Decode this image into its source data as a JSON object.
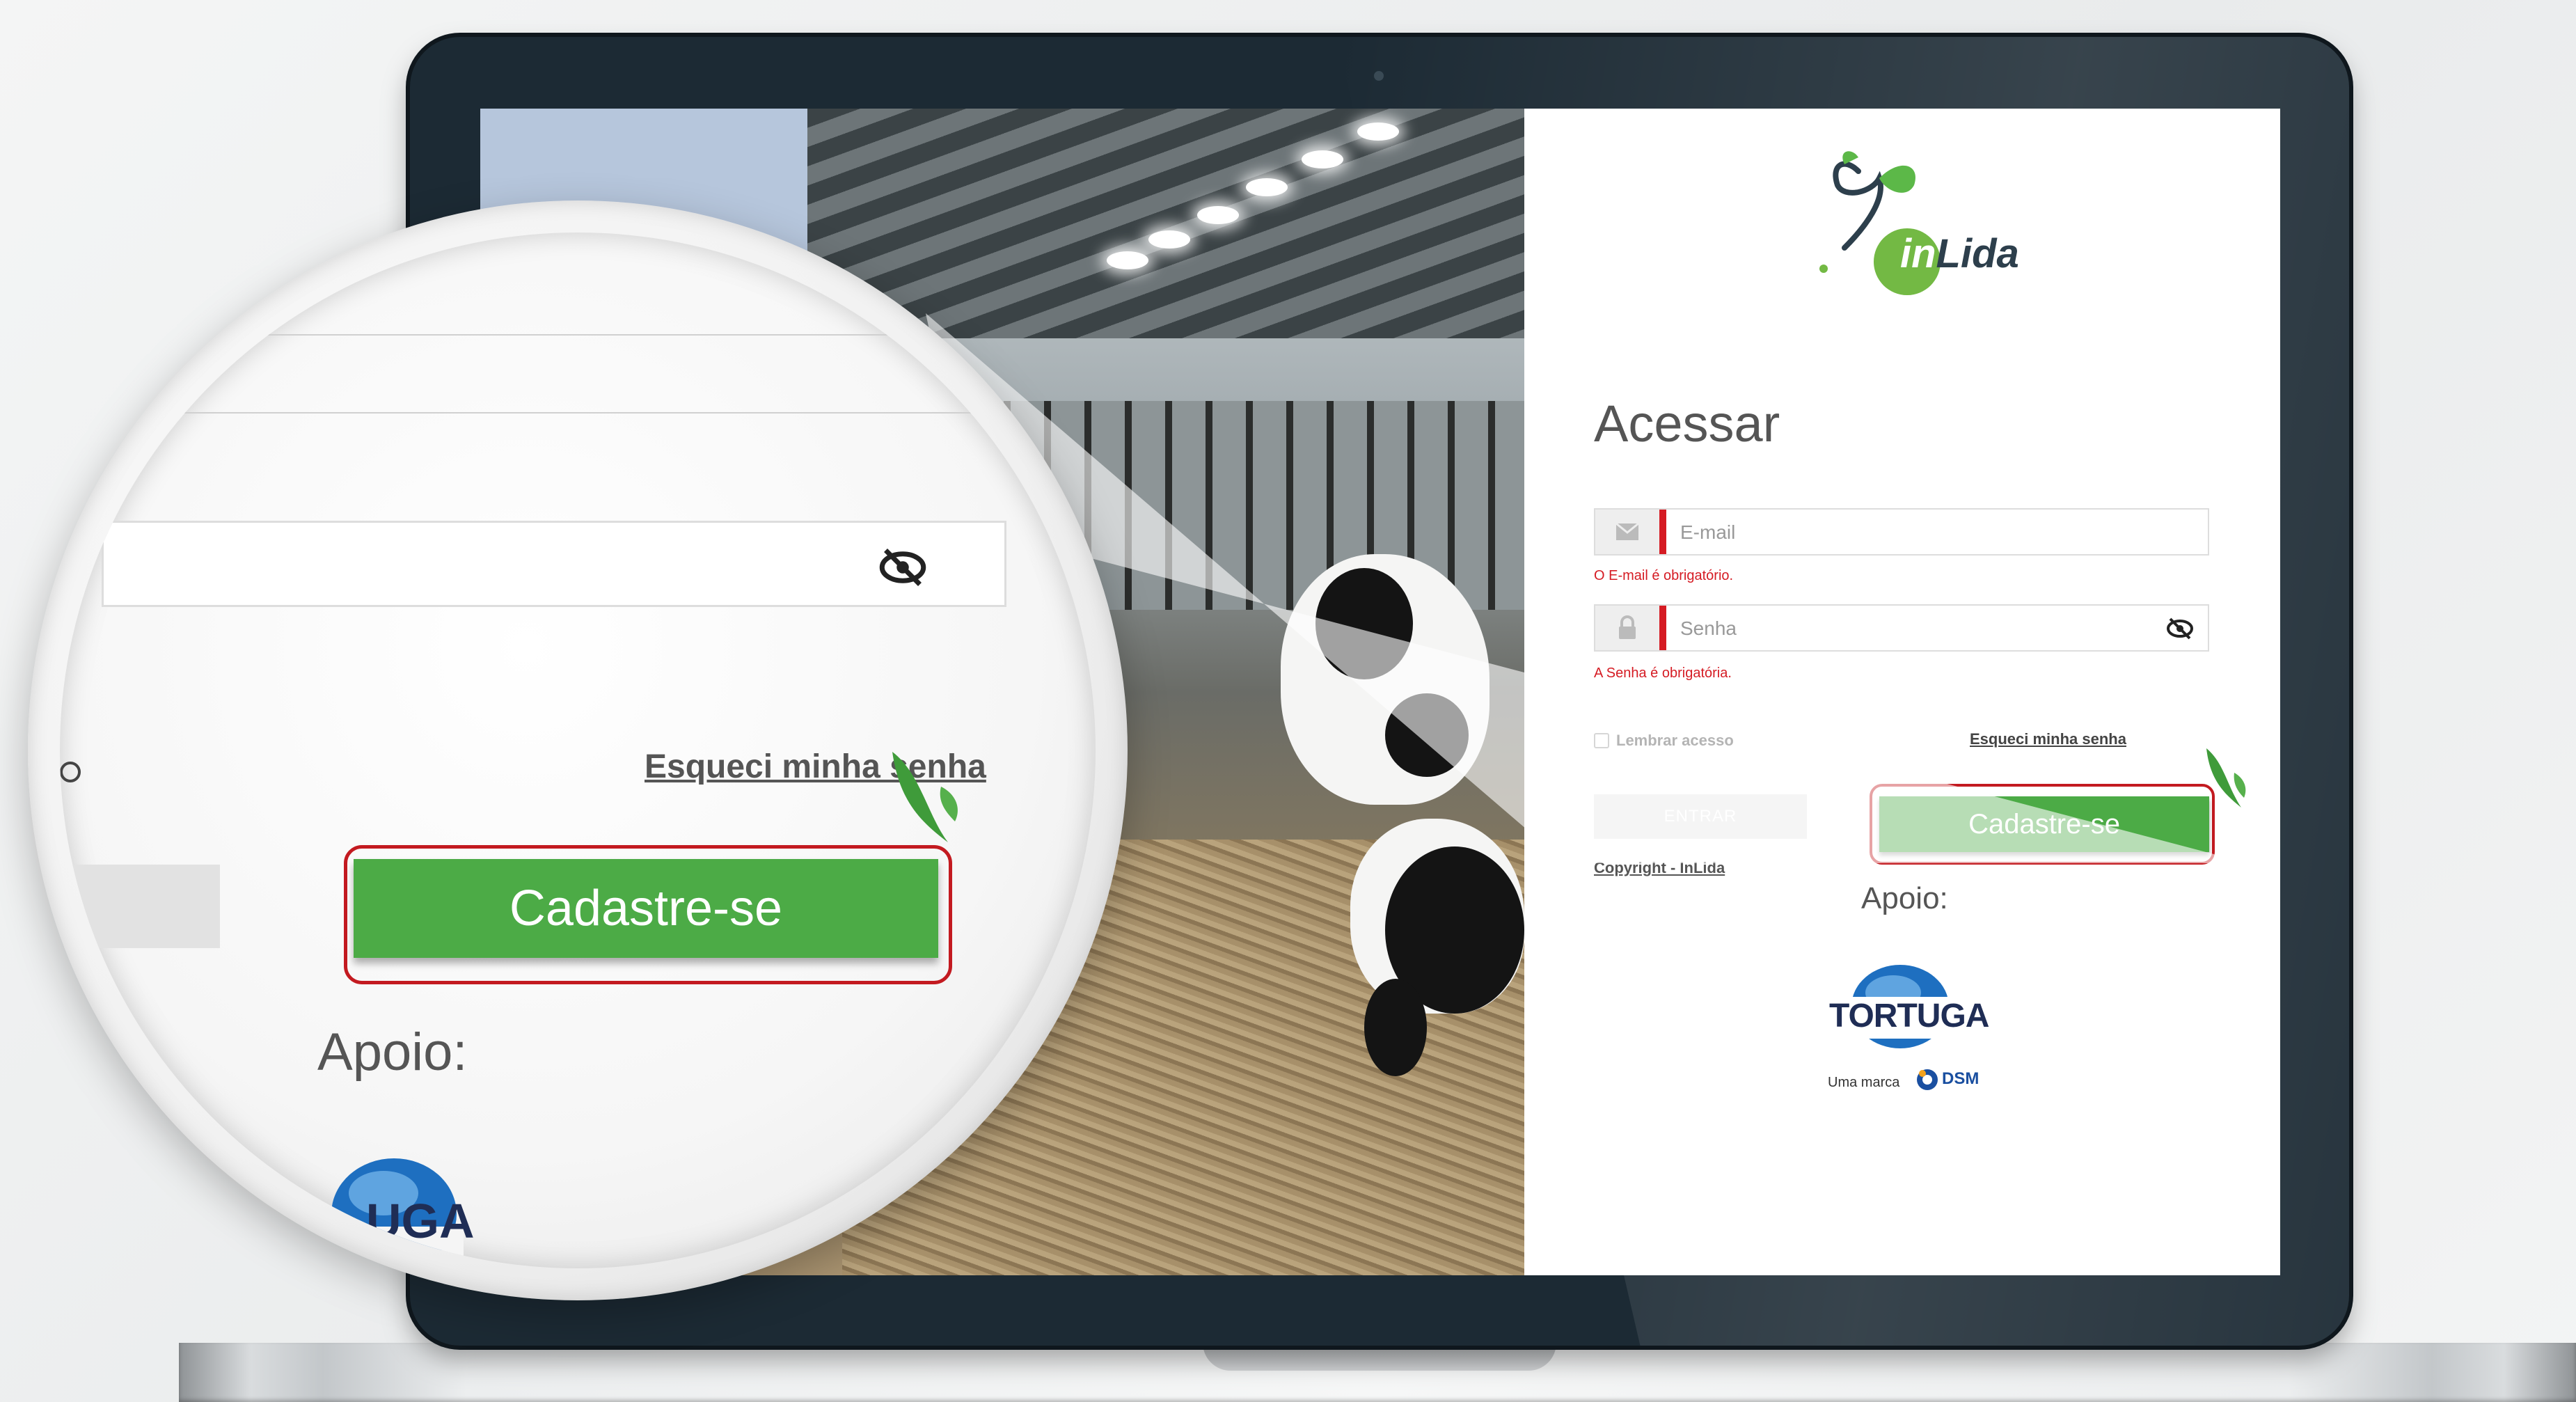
{
  "app": {
    "name": "InLida"
  },
  "login": {
    "title": "Acessar",
    "email": {
      "placeholder": "E-mail",
      "value": "",
      "error": "O E-mail é obrigatório."
    },
    "password": {
      "placeholder": "Senha",
      "value": "",
      "error": "A Senha é obrigatória."
    },
    "remember_label": "Lembrar acesso",
    "forgot_label": "Esqueci minha senha",
    "enter_label": "ENTRAR",
    "signup_label": "Cadastre-se",
    "copyright": "Copyright - InLida",
    "support_label": "Apoio:",
    "sponsor": {
      "name": "TORTUGA",
      "tagline": "Uma marca",
      "brand": "DSM"
    }
  },
  "logo": {
    "prefix": "in",
    "suffix": "Lida"
  },
  "colors": {
    "accent_green": "#4cab46",
    "error_red": "#d51b23",
    "highlight_red": "#c31a20",
    "bezel": "#1c2a34"
  },
  "icons": [
    "envelope-icon",
    "lock-icon",
    "eye-slash-icon",
    "leaf-logo-icon",
    "tortuga-globe-icon",
    "dsm-logo-icon"
  ],
  "magnifier": {
    "forgot_label": "Esqueci minha senha",
    "signup_label": "Cadastre-se",
    "support_label": "Apoio:",
    "sponsor_partial": "UGA"
  }
}
